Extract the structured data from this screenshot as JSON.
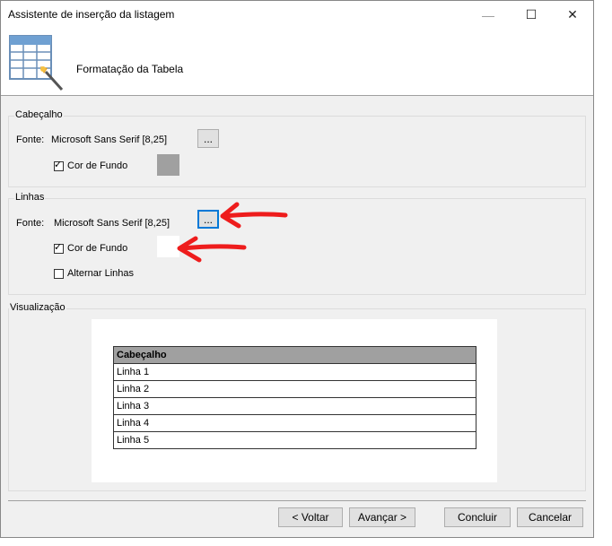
{
  "window": {
    "title": "Assistente de inserção da listagem",
    "controls": {
      "minimize": "—",
      "maximize": "☐",
      "close": "✕"
    }
  },
  "header": {
    "title": "Formatação da Tabela",
    "icon": "table-wizard-icon"
  },
  "cabecalho": {
    "group_label": "Cabeçalho",
    "font_label": "Fonte:",
    "font_value": "Microsoft Sans Serif [8,25]",
    "font_button": "...",
    "bg_checkbox_label": "Cor de Fundo",
    "bg_checked": true,
    "bg_color": "#a0a0a0"
  },
  "linhas": {
    "group_label": "Linhas",
    "font_label": "Fonte:",
    "font_value": "Microsoft Sans Serif [8,25]",
    "font_button": "...",
    "bg_checkbox_label": "Cor de Fundo",
    "bg_checked": true,
    "bg_color": "#ffffff",
    "alternate_label": "Alternar Linhas",
    "alternate_checked": false
  },
  "preview": {
    "group_label": "Visualização",
    "header_cell": "Cabeçalho",
    "rows": [
      "Linha 1",
      "Linha 2",
      "Linha 3",
      "Linha 4",
      "Linha 5"
    ]
  },
  "buttons": {
    "back": "< Voltar",
    "next": "Avançar >",
    "finish": "Concluir",
    "cancel": "Cancelar"
  },
  "colors": {
    "annotation_arrow": "#ee1c1c",
    "focus_border": "#0078d7"
  }
}
